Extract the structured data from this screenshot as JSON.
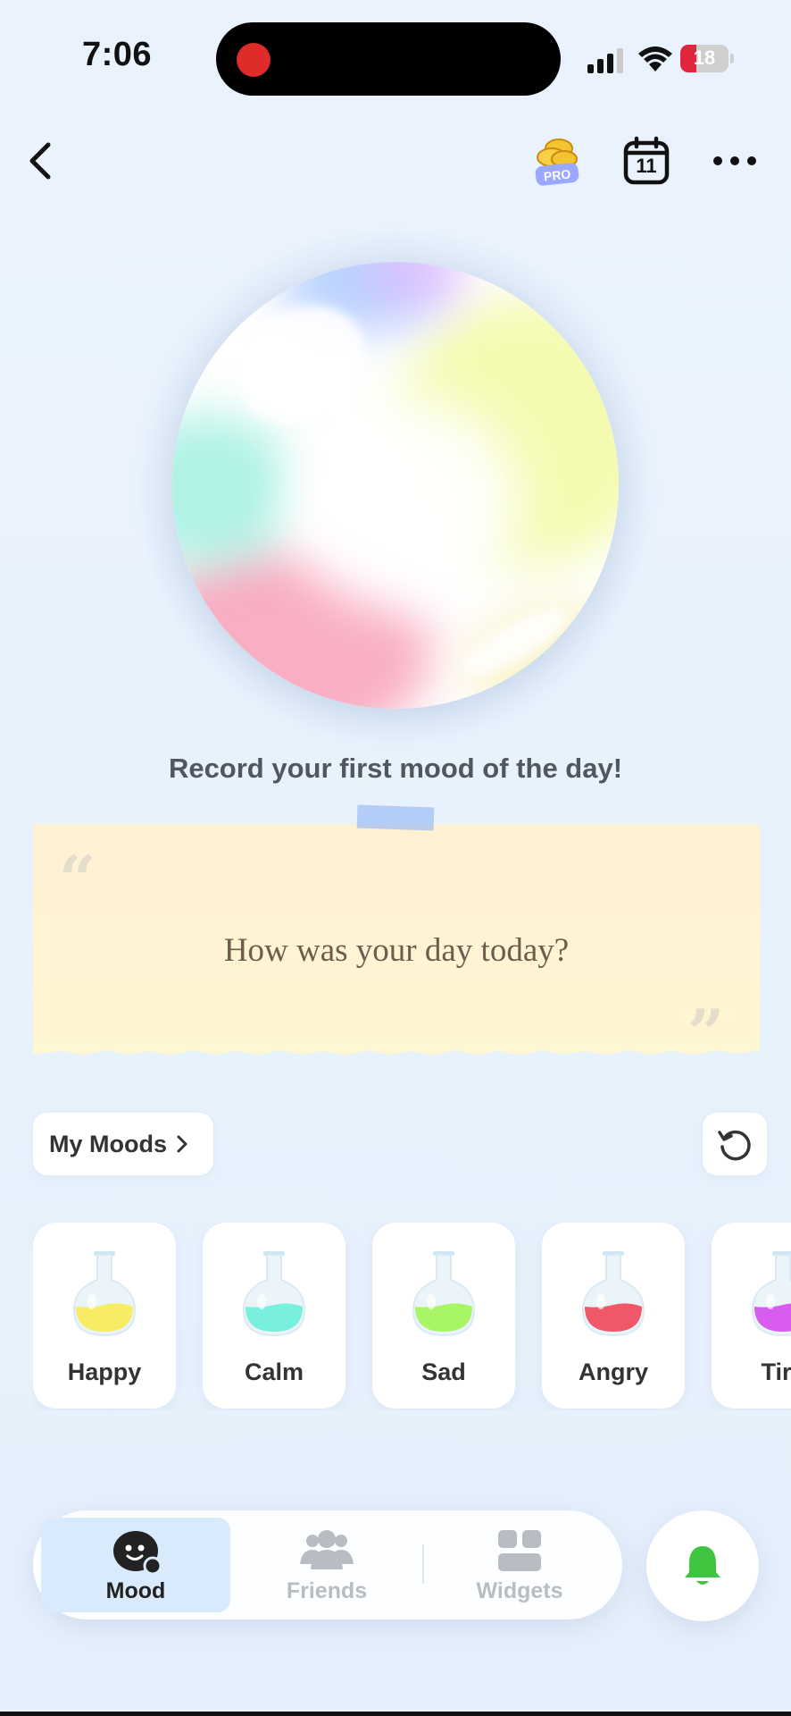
{
  "status_bar": {
    "time": "7:06",
    "battery": "18"
  },
  "top_bar": {
    "calendar_day": "11",
    "pro_label": "PRO"
  },
  "mood_prompt": "Record your first mood of the day!",
  "note": {
    "text": "How was your day today?",
    "quote_open": "“",
    "quote_close": "”"
  },
  "my_moods_label": "My Moods",
  "moods": [
    {
      "label": "Happy",
      "color": "#f7ec63"
    },
    {
      "label": "Calm",
      "color": "#78f0dc"
    },
    {
      "label": "Sad",
      "color": "#a8f566"
    },
    {
      "label": "Angry",
      "color": "#f0586a"
    },
    {
      "label": "Tire",
      "color": "#d85cf0"
    }
  ],
  "tabs": [
    {
      "label": "Mood",
      "active": true
    },
    {
      "label": "Friends",
      "active": false
    },
    {
      "label": "Widgets",
      "active": false
    }
  ],
  "colors": {
    "accent_green": "#3fc53f",
    "tab_active_bg": "#d8eafc",
    "note_bg": "#fff3d3"
  }
}
